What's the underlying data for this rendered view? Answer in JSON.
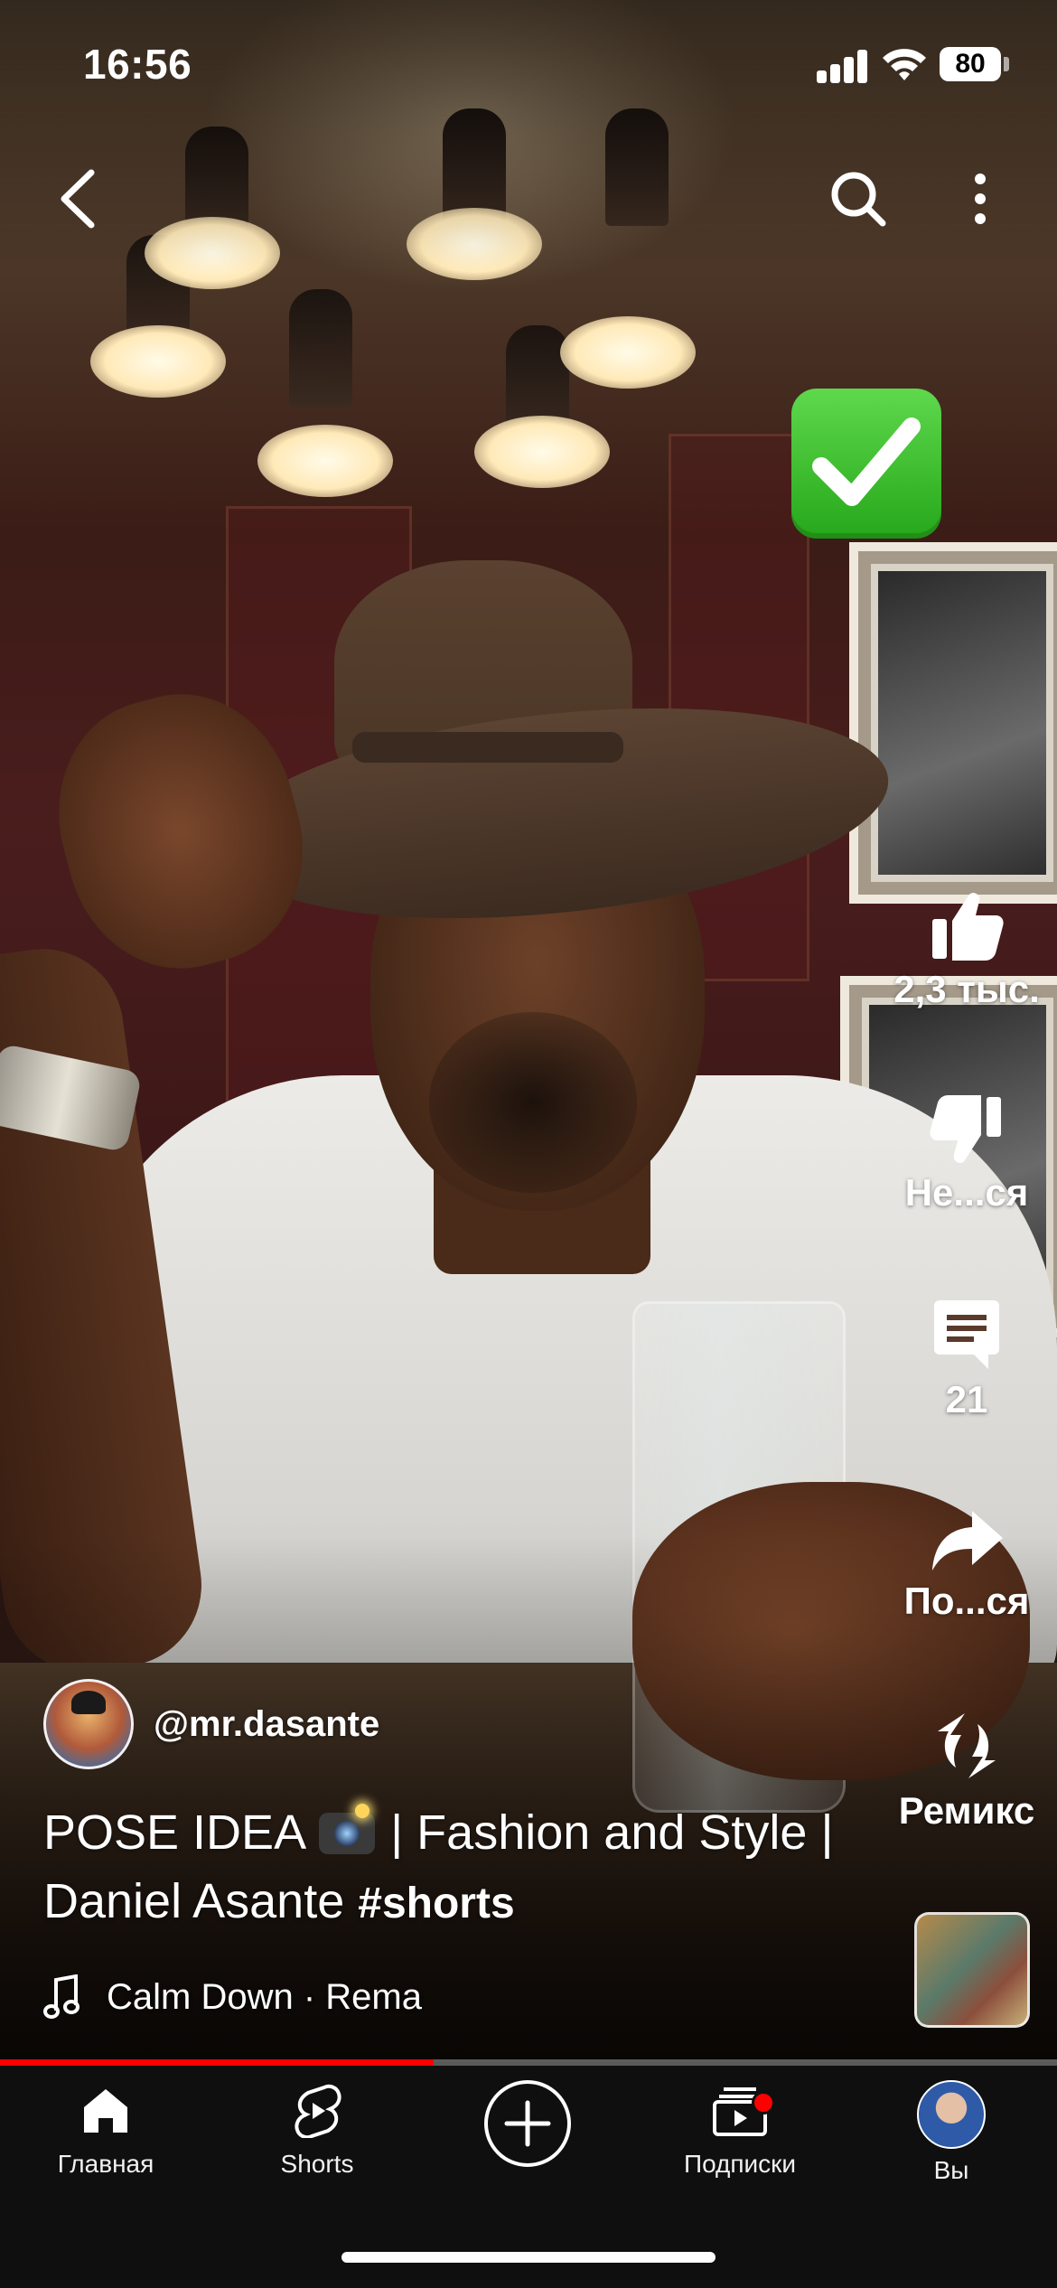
{
  "status_bar": {
    "time": "16:56",
    "battery": "80"
  },
  "top_bar": {
    "back_icon": "chevron-left-icon",
    "search_icon": "search-icon",
    "more_icon": "more-vertical-icon"
  },
  "overlay_emoji": "check-mark-button-emoji",
  "actions": {
    "like": {
      "icon": "thumbs-up-icon",
      "label": "2,3 тыс."
    },
    "dislike": {
      "icon": "thumbs-down-icon",
      "label": "Не...ся"
    },
    "comments": {
      "icon": "comment-icon",
      "label": "21"
    },
    "share": {
      "icon": "share-icon",
      "label": "По...ся"
    },
    "remix": {
      "icon": "remix-icon",
      "label": "Ремикс"
    }
  },
  "video": {
    "channel": "@mr.dasante",
    "title": "POSE IDEA 📸 | Fashion and Style | Daniel Asante",
    "title_part1": "POSE IDEA",
    "title_part2": "| Fashion and Style | Daniel Asante",
    "hashtag": "#shorts",
    "music": "Calm Down · Rema",
    "progress": 0.41
  },
  "nav": {
    "items": [
      {
        "label": "Главная",
        "icon": "home-icon"
      },
      {
        "label": "Shorts",
        "icon": "shorts-icon"
      },
      {
        "label": "",
        "icon": "plus-circle-icon"
      },
      {
        "label": "Подписки",
        "icon": "subscriptions-icon"
      },
      {
        "label": "Вы",
        "icon": "user-avatar"
      }
    ]
  },
  "colors": {
    "accent": "#ff0000",
    "nav_bg": "#0f0f0f",
    "text": "#ffffff"
  }
}
